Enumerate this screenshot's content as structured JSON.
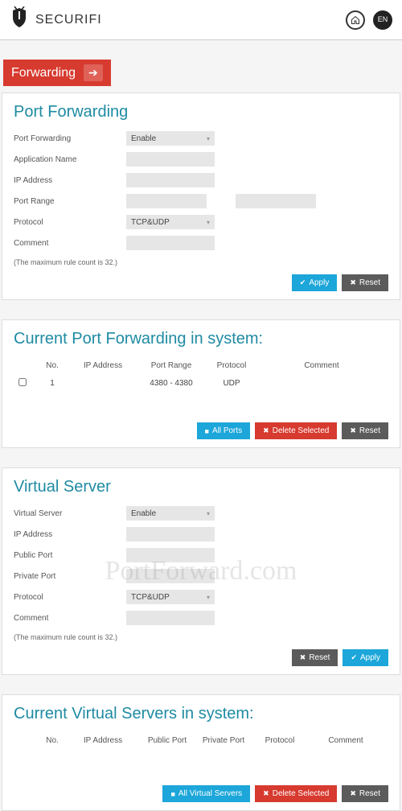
{
  "brand": {
    "name": "SECURIFI"
  },
  "tab": {
    "label": "Forwarding"
  },
  "pf": {
    "title": "Port Forwarding",
    "labels": {
      "pf": "Port Forwarding",
      "app": "Application Name",
      "ip": "IP Address",
      "range": "Port Range",
      "proto": "Protocol",
      "comment": "Comment"
    },
    "values": {
      "mode": "Enable",
      "proto": "TCP&UDP"
    },
    "hint": "(The maximum rule count is 32.)",
    "btn_apply": "Apply",
    "btn_reset": "Reset"
  },
  "pf_list": {
    "title": "Current Port Forwarding in system:",
    "headers": {
      "no": "No.",
      "ip": "IP Address",
      "range": "Port Range",
      "proto": "Protocol",
      "comment": "Comment"
    },
    "rows": [
      {
        "no": "1",
        "ip": "",
        "range": "4380 - 4380",
        "proto": "UDP",
        "comment": ""
      }
    ],
    "btn_all": "All Ports",
    "btn_del": "Delete Selected",
    "btn_reset": "Reset"
  },
  "vs": {
    "title": "Virtual Server",
    "labels": {
      "vs": "Virtual Server",
      "ip": "IP Address",
      "pub": "Public Port",
      "prv": "Private Port",
      "proto": "Protocol",
      "comment": "Comment"
    },
    "values": {
      "mode": "Enable",
      "proto": "TCP&UDP"
    },
    "hint": "(The maximum rule count is 32.)",
    "btn_reset": "Reset",
    "btn_apply": "Apply"
  },
  "vs_list": {
    "title": "Current Virtual Servers in system:",
    "headers": {
      "no": "No.",
      "ip": "IP Address",
      "pub": "Public Port",
      "prv": "Private Port",
      "proto": "Protocol",
      "comment": "Comment"
    },
    "btn_all": "All Virtual Servers",
    "btn_del": "Delete Selected",
    "btn_reset": "Reset"
  }
}
